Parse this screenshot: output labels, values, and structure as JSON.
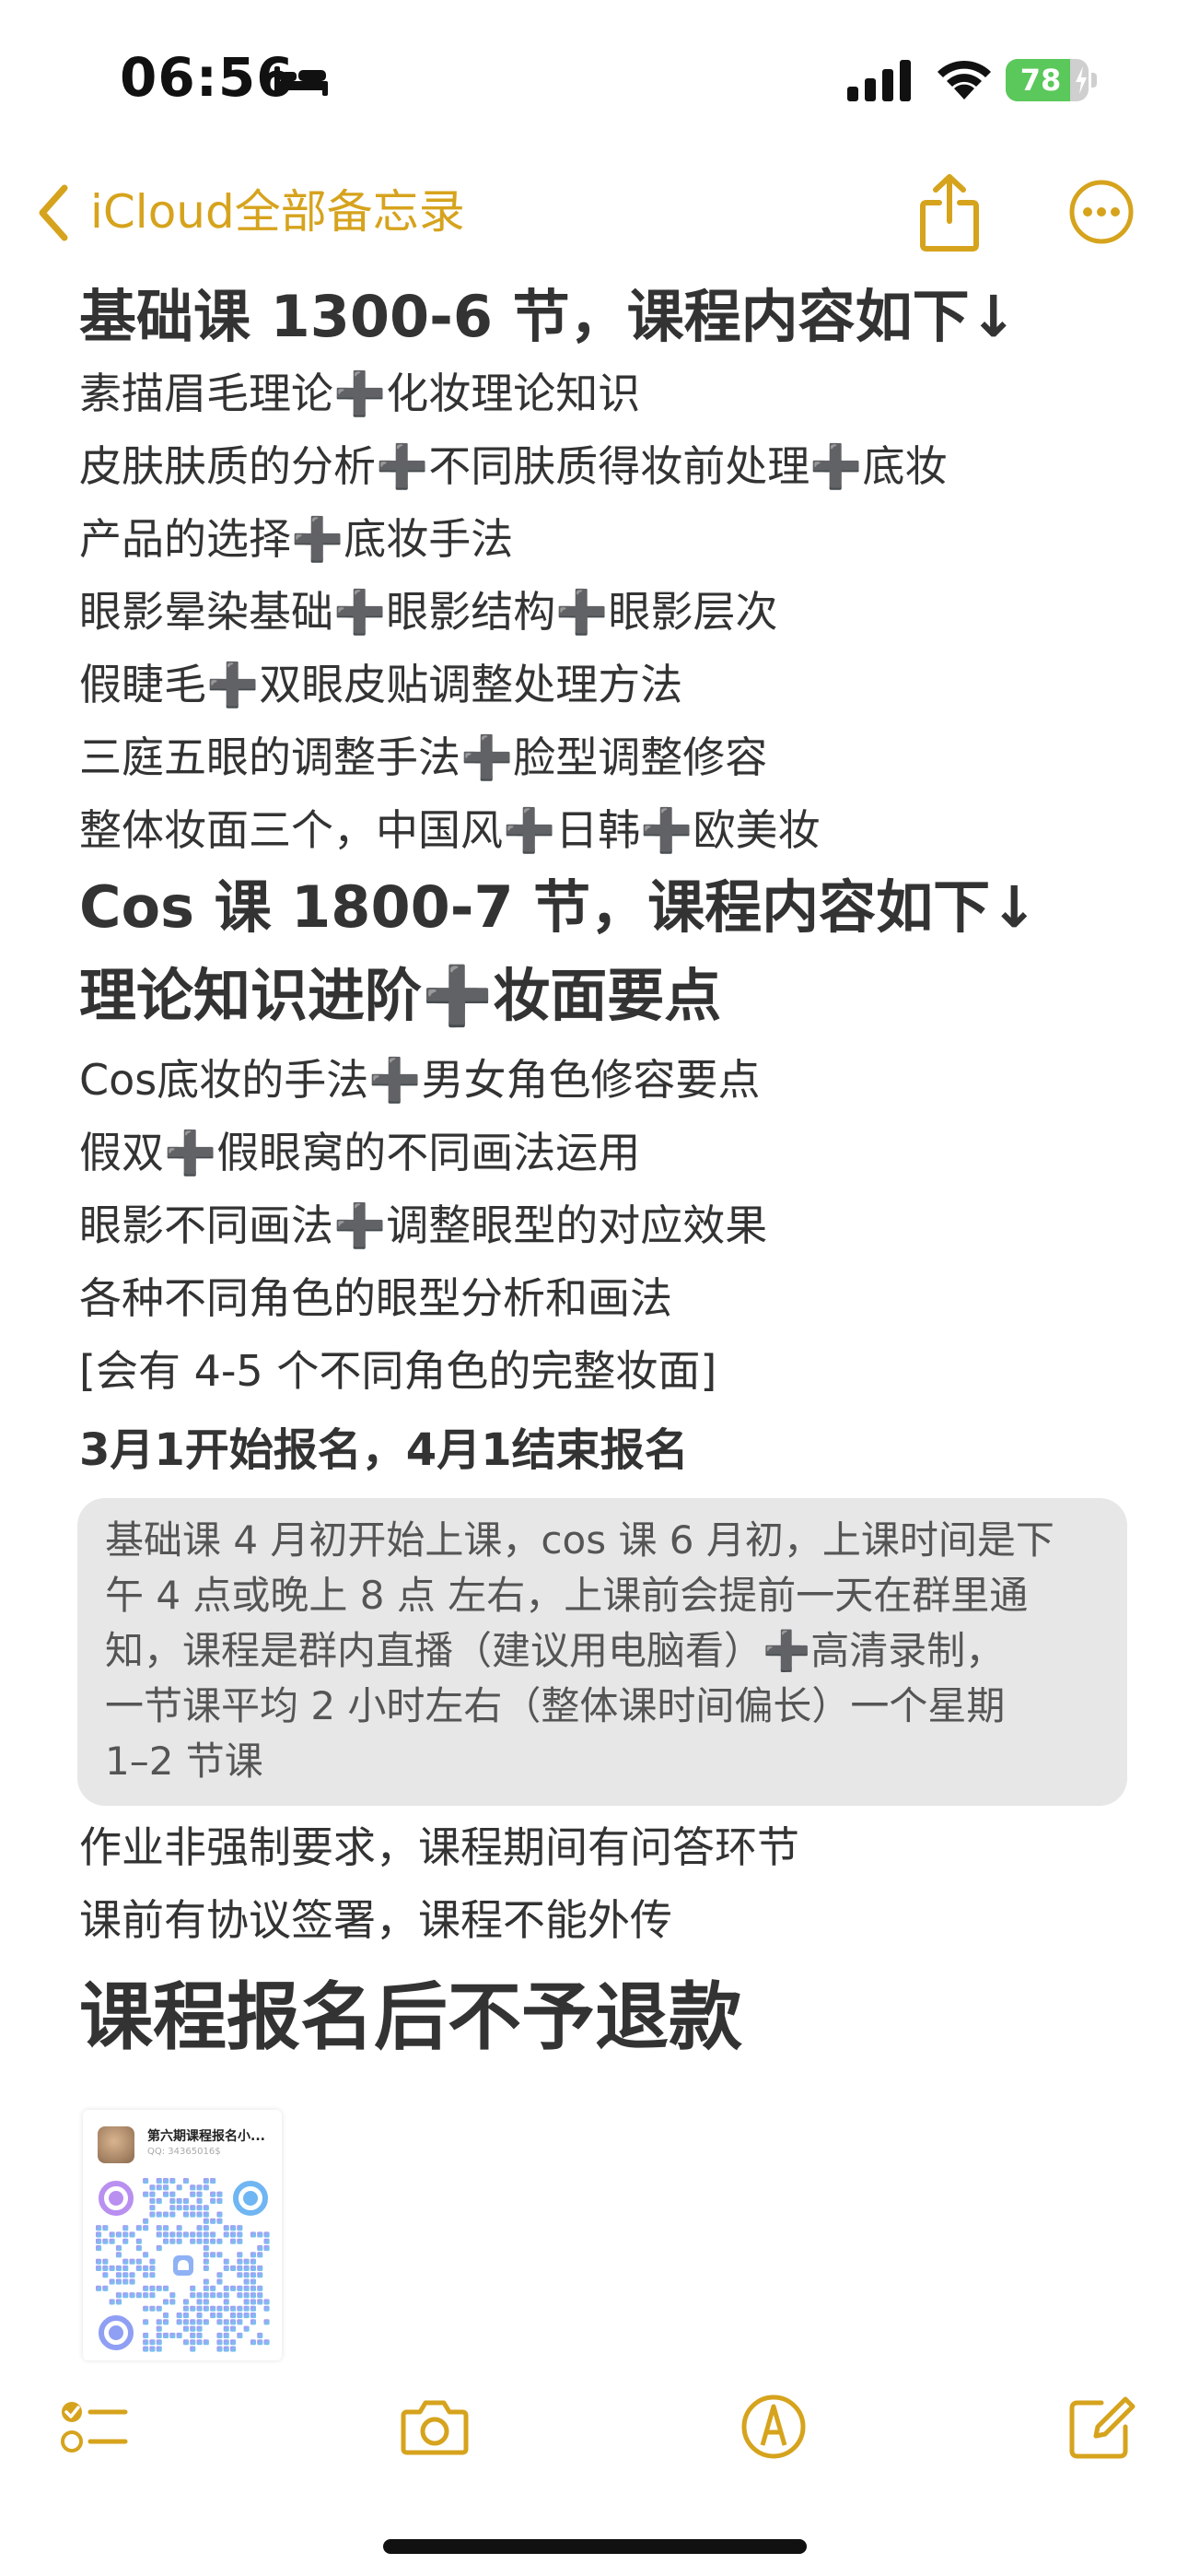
{
  "status_bar": {
    "time": "06:56",
    "focus_icon": "bed-icon",
    "signal_icon": "cellular-signal-icon",
    "wifi_icon": "wifi-icon",
    "battery_percent": "78",
    "battery_level": 0.78,
    "battery_color": "#5ac85a",
    "charging": true
  },
  "nav": {
    "back_label": "iCloud全部备忘录",
    "accent_color": "#d6a31d",
    "share_icon": "share-icon",
    "more_icon": "more-ellipsis-icon"
  },
  "note": {
    "basic": {
      "heading": "基础课 1300-6 节，课程内容如下↓",
      "lines": [
        "素描眉毛理论➕化妆理论知识",
        "皮肤肤质的分析➕不同肤质得妆前处理➕底妆",
        "产品的选择➕底妆手法",
        "眼影晕染基础➕眼影结构➕眼影层次",
        "假睫毛➕双眼皮贴调整处理方法",
        "三庭五眼的调整手法➕脸型调整修容",
        "整体妆面三个，中国风➕日韩➕欧美妆"
      ]
    },
    "cos": {
      "heading": "Cos 课 1800-7 节，课程内容如下↓",
      "subheading": "理论知识进阶➕妆面要点",
      "lines": [
        "Cos底妆的手法➕男女角色修容要点",
        "假双➕假眼窝的不同画法运用",
        "眼影不同画法➕调整眼型的对应效果",
        "各种不同角色的眼型分析和画法",
        "[会有 4-5 个不同角色的完整妆面]"
      ]
    },
    "registration": "3月1开始报名，4月1结束报名",
    "schedule_block": [
      "基础课 4 月初开始上课，cos 课 6 月初，上课时间是下",
      "午 4 点或晚上 8 点  左右，上课前会提前一天在群里通",
      "知，课程是群内直播（建议用电脑看）➕高清录制，",
      "一节课平均 2 小时左右（整体课时间偏长）一个星期",
      "1–2 节课"
    ],
    "after_lines": [
      "作业非强制要求，课程期间有问答环节",
      "课前有协议签署，课程不能外传"
    ],
    "no_refund": "课程报名后不予退款",
    "qr_card": {
      "title": "第六期课程报名小...",
      "subtitle": "QQ: 34365016$"
    }
  },
  "toolbar": {
    "checklist_icon": "checklist-icon",
    "camera_icon": "camera-icon",
    "markup_icon": "markup-pen-icon",
    "compose_icon": "compose-icon"
  }
}
